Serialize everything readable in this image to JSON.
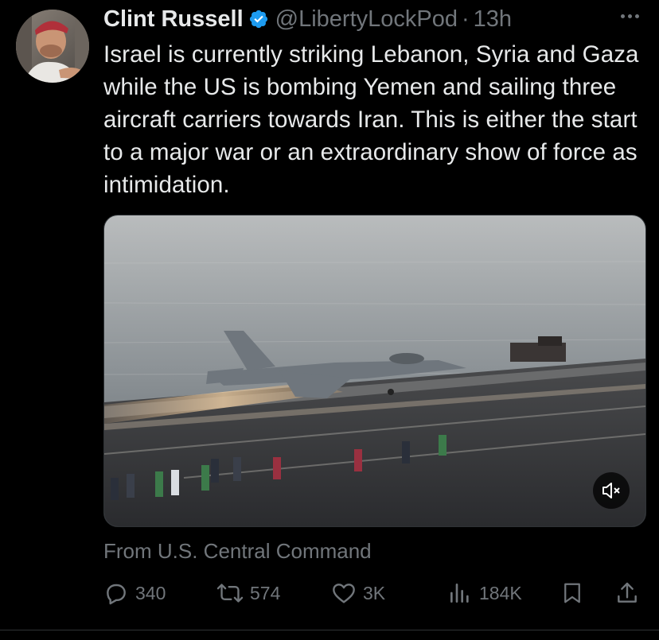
{
  "tweet": {
    "author_name": "Clint Russell",
    "handle": "@LibertyLockPod",
    "separator": "·",
    "timestamp": "13h",
    "text": "Israel is currently striking Lebanon, Syria and Gaza while the US is bombing Yemen and sailing three aircraft carriers towards Iran. This is either the start to a major war or an extraordinary show of force as intimidation.",
    "media_source": "From U.S. Central Command"
  },
  "actions": {
    "replies": "340",
    "reposts": "574",
    "likes": "3K",
    "views": "184K"
  },
  "icons": {
    "verified": "verified-badge-icon",
    "more": "more-dots-icon",
    "mute": "muted-speaker-icon",
    "reply": "reply-bubble-icon",
    "repost": "repost-arrows-icon",
    "like": "heart-icon",
    "views": "views-bar-chart-icon",
    "bookmark": "bookmark-icon",
    "share": "share-icon"
  },
  "colors": {
    "background": "#000000",
    "text_primary": "#e7e9ea",
    "text_secondary": "#71767b",
    "verified_blue": "#1d9bf0"
  }
}
